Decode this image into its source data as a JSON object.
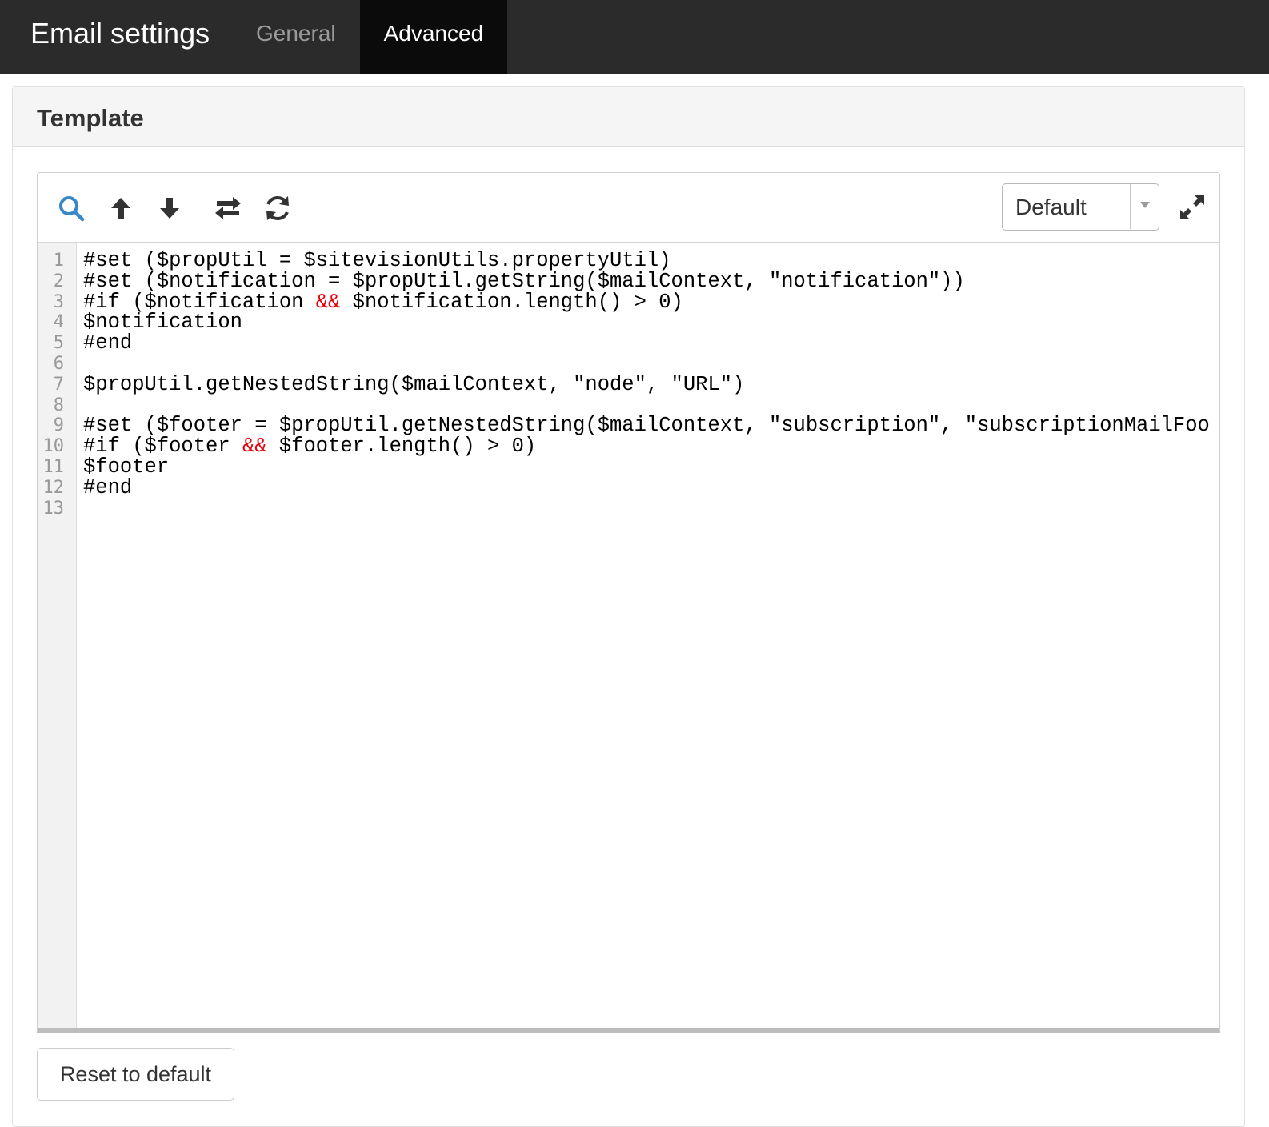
{
  "header": {
    "title": "Email settings",
    "tabs": [
      {
        "label": "General",
        "active": false
      },
      {
        "label": "Advanced",
        "active": true
      }
    ]
  },
  "panel": {
    "title": "Template"
  },
  "editor": {
    "toolbar": {
      "icons": [
        "search-icon",
        "arrow-up-icon",
        "arrow-down-icon",
        "replace-icon",
        "refresh-icon"
      ],
      "theme_select": {
        "value": "Default"
      },
      "expand_icon": "expand-icon"
    },
    "line_numbers": [
      "1",
      "2",
      "3",
      "4",
      "5",
      "6",
      "7",
      "8",
      "9",
      "10",
      "11",
      "12",
      "13"
    ],
    "lines": [
      {
        "segments": [
          {
            "t": "#set ($propUtil = $sitevisionUtils.propertyUtil)"
          }
        ]
      },
      {
        "segments": [
          {
            "t": "#set ($notification = $propUtil.getString($mailContext, \"notification\"))"
          }
        ]
      },
      {
        "segments": [
          {
            "t": "#if ($notification "
          },
          {
            "t": "&&",
            "op": true
          },
          {
            "t": " $notification.length() > 0)"
          }
        ]
      },
      {
        "segments": [
          {
            "t": "$notification"
          }
        ]
      },
      {
        "segments": [
          {
            "t": "#end"
          }
        ]
      },
      {
        "segments": [
          {
            "t": ""
          }
        ]
      },
      {
        "segments": [
          {
            "t": "$propUtil.getNestedString($mailContext, \"node\", \"URL\")"
          }
        ]
      },
      {
        "segments": [
          {
            "t": ""
          }
        ]
      },
      {
        "segments": [
          {
            "t": "#set ($footer = $propUtil.getNestedString($mailContext, \"subscription\", \"subscriptionMailFoo"
          }
        ]
      },
      {
        "segments": [
          {
            "t": "#if ($footer "
          },
          {
            "t": "&&",
            "op": true
          },
          {
            "t": " $footer.length() > 0)"
          }
        ]
      },
      {
        "segments": [
          {
            "t": "$footer"
          }
        ]
      },
      {
        "segments": [
          {
            "t": "#end"
          }
        ]
      },
      {
        "segments": [
          {
            "t": ""
          }
        ]
      }
    ],
    "colors": {
      "operator": "#e8000b",
      "search_icon": "#3a87c8",
      "header_bg": "#2b2b2b",
      "active_tab_bg": "#0b0b0b"
    }
  },
  "footer": {
    "reset_label": "Reset to default"
  }
}
